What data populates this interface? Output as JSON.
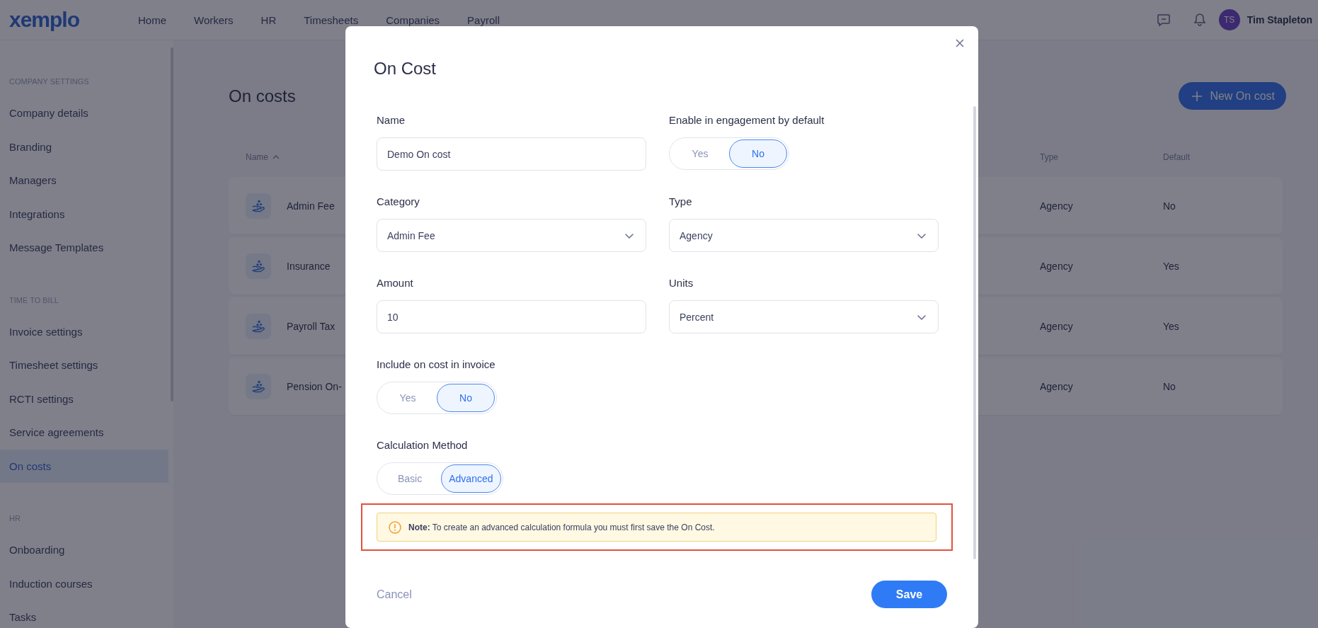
{
  "header": {
    "logo": "xemplo",
    "nav": [
      "Home",
      "Workers",
      "HR",
      "Timesheets",
      "Companies",
      "Payroll"
    ],
    "user": {
      "initials": "TS",
      "name": "Tim Stapleton"
    }
  },
  "sidebar": {
    "sections": [
      {
        "title": "COMPANY SETTINGS",
        "items": [
          {
            "label": "Company details",
            "selected": false
          },
          {
            "label": "Branding",
            "selected": false
          },
          {
            "label": "Managers",
            "selected": false
          },
          {
            "label": "Integrations",
            "selected": false
          },
          {
            "label": "Message Templates",
            "selected": false
          }
        ]
      },
      {
        "title": "TIME TO BILL",
        "items": [
          {
            "label": "Invoice settings",
            "selected": false
          },
          {
            "label": "Timesheet settings",
            "selected": false
          },
          {
            "label": "RCTI settings",
            "selected": false
          },
          {
            "label": "Service agreements",
            "selected": false
          },
          {
            "label": "On costs",
            "selected": true
          }
        ]
      },
      {
        "title": "HR",
        "items": [
          {
            "label": "Onboarding",
            "selected": false
          },
          {
            "label": "Induction courses",
            "selected": false
          },
          {
            "label": "Tasks",
            "selected": false
          }
        ]
      }
    ]
  },
  "page": {
    "title": "On costs",
    "new_button": "New On cost",
    "columns": [
      {
        "label": "Name",
        "sorted": true
      },
      {
        "label": "Type",
        "sorted": false
      },
      {
        "label": "Default",
        "sorted": false
      }
    ],
    "rows": [
      {
        "name": "Admin Fee",
        "type": "Agency",
        "default": "No"
      },
      {
        "name": "Insurance",
        "type": "Agency",
        "default": "Yes"
      },
      {
        "name": "Payroll Tax",
        "type": "Agency",
        "default": "Yes"
      },
      {
        "name": "Pension On-",
        "type": "Agency",
        "default": "No"
      }
    ]
  },
  "modal": {
    "title": "On Cost",
    "rows": [
      [
        {
          "kind": "text",
          "label": "Name",
          "value": "Demo On cost"
        },
        {
          "kind": "toggle",
          "label": "Enable in engagement by default",
          "options": [
            {
              "label": "Yes",
              "selected": false
            },
            {
              "label": "No",
              "selected": true
            }
          ]
        }
      ],
      [
        {
          "kind": "select",
          "label": "Category",
          "value": "Admin Fee"
        },
        {
          "kind": "select",
          "label": "Type",
          "value": "Agency"
        }
      ],
      [
        {
          "kind": "text",
          "label": "Amount",
          "value": "10"
        },
        {
          "kind": "select",
          "label": "Units",
          "value": "Percent"
        }
      ],
      [
        {
          "kind": "toggle",
          "label": "Include on cost in invoice",
          "options": [
            {
              "label": "Yes",
              "selected": false
            },
            {
              "label": "No",
              "selected": true
            }
          ]
        }
      ],
      [
        {
          "kind": "toggle",
          "label": "Calculation Method",
          "options": [
            {
              "label": "Basic",
              "selected": false
            },
            {
              "label": "Advanced",
              "selected": true
            }
          ]
        }
      ]
    ],
    "note": {
      "text": "**Note:** To create an advanced calculation formula you must first save the On Cost.",
      "highlighted": true
    },
    "cancel": "Cancel",
    "save": "Save"
  }
}
